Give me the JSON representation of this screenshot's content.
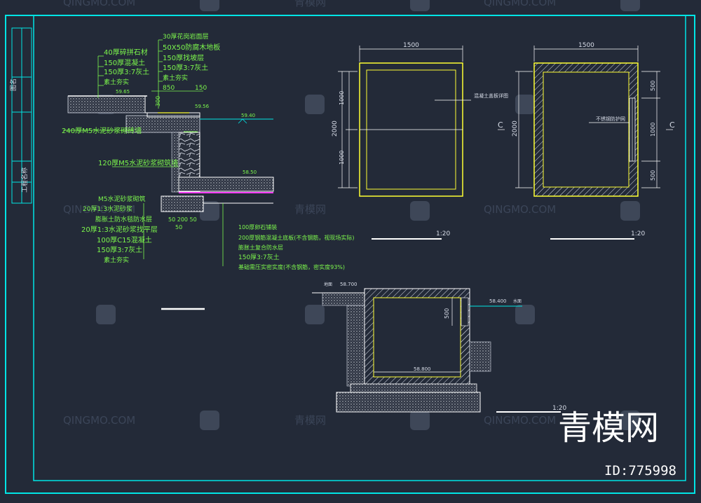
{
  "watermark": {
    "text_en": "QINGMO.COM",
    "text_cn": "青模网",
    "brand": "青模网",
    "id": "ID:775998"
  },
  "section_left": {
    "top_layers": [
      "30厚花岗岩面层",
      "50X50防腐木地板",
      "150厚找坡层",
      "150厚3:7灰土",
      "素土夯实"
    ],
    "left_layers": [
      "40厚碎拼石材",
      "150厚混凝土",
      "150厚3:7灰土",
      "素土夯实"
    ],
    "elev_top": "59.65",
    "elev_top2": "59.56",
    "dim_850": "850",
    "dim_150": "150",
    "dim_300": "300",
    "water_level": "59.40",
    "bottom_elev": "58.50",
    "wall_note": "240厚M5水泥砂浆砌砖墙",
    "wall_note2": "120厚M5水泥砂浆砌筑墙",
    "base_dims": "50  200  50",
    "dim_50": "50",
    "left_bottom_layers": [
      "M5水泥砂浆砌筑",
      "20厚1:3水泥砂浆",
      "膨胀土防水毯防水层",
      "20厚1:3水泥砂浆找平层",
      "100厚C15混凝土",
      "150厚3:7灰土",
      "素土夯实"
    ],
    "right_bottom_layers": [
      "100厚卵石铺装",
      "200厚钢筋混凝土底板(不含钢筋，视现场实际)",
      "膨胀土复合防水层",
      "150厚3:7灰土",
      "基础需压实密实度(不含钢筋，密实度93%)"
    ]
  },
  "plan_1": {
    "width": "1500",
    "height": "2000",
    "half_top": "1000",
    "half_bottom": "1000",
    "label": "混凝土盖板详图",
    "scale": "1:20"
  },
  "plan_2": {
    "width": "1500",
    "height": "2000",
    "dims_right": [
      "500",
      "1000",
      "500"
    ],
    "label": "不锈钢防护网",
    "section_mark": "C",
    "scale": "1:20"
  },
  "section_c": {
    "ground_label": "地面",
    "ground_elev": "58.700",
    "water_elev": "58.400",
    "water_label": "水面",
    "dim_500": "500",
    "bottom_elev": "58.800",
    "scale": "1:20"
  },
  "title_block": {
    "label_top": "图名",
    "label_bottom": "工程名称"
  },
  "colors": {
    "background": "#232a38",
    "frame": "#00e5e5",
    "outline": "#ffff33",
    "annotation": "#7cf74c",
    "line": "#ffffff"
  }
}
